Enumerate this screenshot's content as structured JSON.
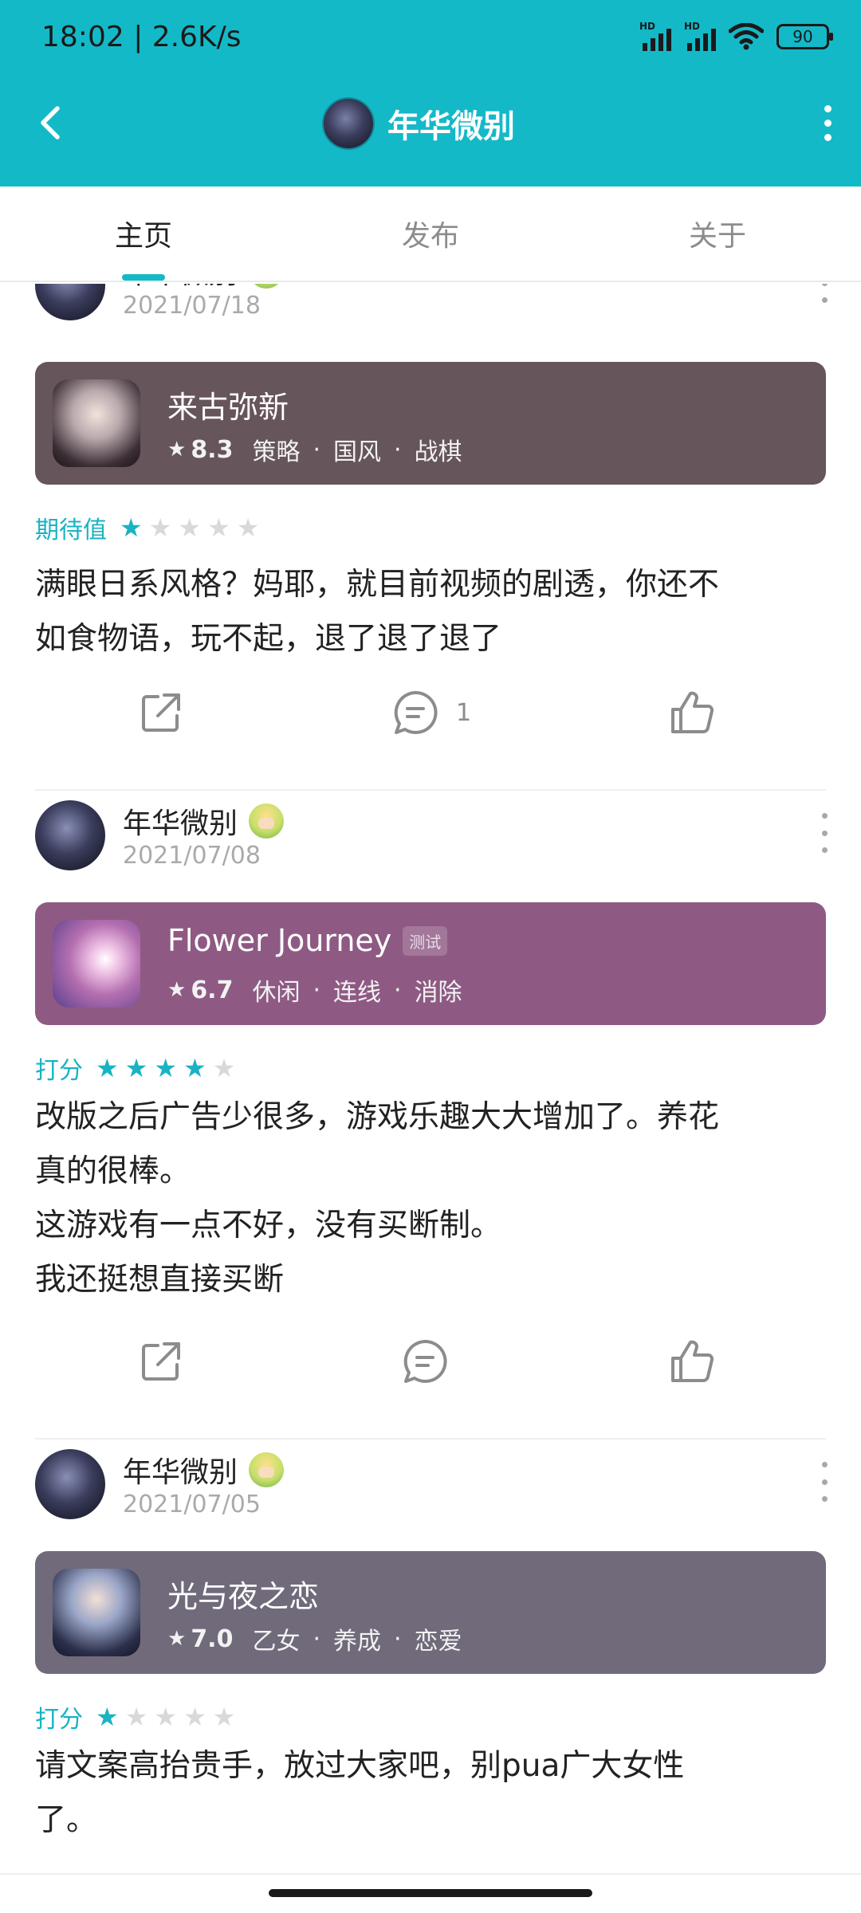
{
  "status_bar": {
    "time": "18:02 | 2.6K/s",
    "battery": "90",
    "network_label": "HD"
  },
  "header": {
    "title": "年华微别"
  },
  "tabs": [
    {
      "label": "主页",
      "active": true
    },
    {
      "label": "发布",
      "active": false
    },
    {
      "label": "关于",
      "active": false
    }
  ],
  "posts": [
    {
      "author": "年华微别",
      "date": "2021/07/18",
      "game": {
        "title": "来古弥新",
        "score": "8.3",
        "tags": [
          "策略",
          "国风",
          "战棋"
        ],
        "tag_badge": "",
        "card_color": "#66555a"
      },
      "rating": {
        "label": "期待值",
        "stars": 1,
        "max": 5
      },
      "body": "满眼日系风格？妈耶，就目前视频的剧透，你还不\n如食物语，玩不起，退了退了退了",
      "comments": "1"
    },
    {
      "author": "年华微别",
      "date": "2021/07/08",
      "game": {
        "title": "Flower Journey",
        "score": "6.7",
        "tags": [
          "休闲",
          "连线",
          "消除"
        ],
        "tag_badge": "测试",
        "card_color": "#8e5a84"
      },
      "rating": {
        "label": "打分",
        "stars": 4,
        "max": 5
      },
      "body": "改版之后广告少很多，游戏乐趣大大增加了。养花\n真的很棒。\n这游戏有一点不好，没有买断制。\n我还挺想直接买断",
      "comments": ""
    },
    {
      "author": "年华微别",
      "date": "2021/07/05",
      "game": {
        "title": "光与夜之恋",
        "score": "7.0",
        "tags": [
          "乙女",
          "养成",
          "恋爱"
        ],
        "tag_badge": "",
        "card_color": "#706a7b"
      },
      "rating": {
        "label": "打分",
        "stars": 1,
        "max": 5
      },
      "body": "请文案高抬贵手，放过大家吧，别pua广大女性\n了。",
      "comments": ""
    }
  ],
  "colors": {
    "accent": "#14b9c8",
    "rating": "#19b3c3"
  },
  "icons": [
    "back-arrow-icon",
    "more-vertical-icon",
    "share-icon",
    "comment-icon",
    "like-icon",
    "star-icon"
  ]
}
